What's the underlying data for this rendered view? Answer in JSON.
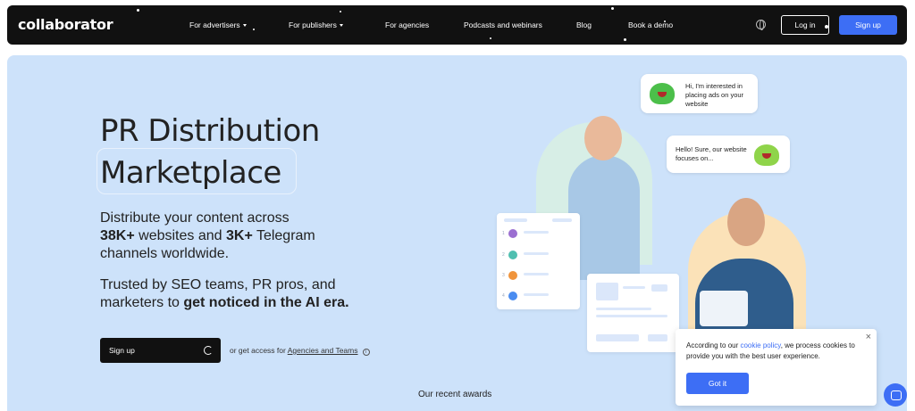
{
  "logo": "collaborator",
  "nav": {
    "items": [
      {
        "label": "For advertisers",
        "dropdown": true
      },
      {
        "label": "For publishers",
        "dropdown": true
      },
      {
        "label": "For agencies",
        "dropdown": false
      },
      {
        "label": "Podcasts and webinars",
        "dropdown": false
      },
      {
        "label": "Blog",
        "dropdown": false
      },
      {
        "label": "Book a demo",
        "dropdown": false
      }
    ],
    "login": "Log in",
    "signup": "Sign up"
  },
  "hero": {
    "title_line1": "PR Distribution",
    "title_line2": "Marketplace",
    "sub1_pre": "Distribute your content across",
    "sub1_b1": "38K+",
    "sub1_mid": " websites and ",
    "sub1_b2": "3K+",
    "sub1_post": " Telegram",
    "sub1_end": "channels worldwide.",
    "sub2_line1": "Trusted by SEO teams, PR pros, and",
    "sub2_pre": "marketers to ",
    "sub2_bold": "get noticed in the AI era.",
    "cta": "Sign up",
    "alt_pre": "or get access for ",
    "alt_link": "Agencies and Teams",
    "awards": "Our recent awards"
  },
  "illustration": {
    "bubble1": "Hi, I'm interested in placing ads on your website",
    "bubble2": "Hello! Sure, our website focuses on...",
    "ranks": [
      "1",
      "2",
      "3",
      "4"
    ],
    "dot_colors": [
      "#9b6fd1",
      "#4fbfb0",
      "#f0943c",
      "#4a8cf0"
    ]
  },
  "cookie": {
    "text_pre": "According to our ",
    "link": "cookie policy",
    "text_post": ", we process cookies to provide you with the best user experience.",
    "button": "Got it",
    "close": "×"
  },
  "colors": {
    "accent": "#3d6ef5",
    "hero_bg": "#cde2fa",
    "nav_bg": "#111111"
  }
}
